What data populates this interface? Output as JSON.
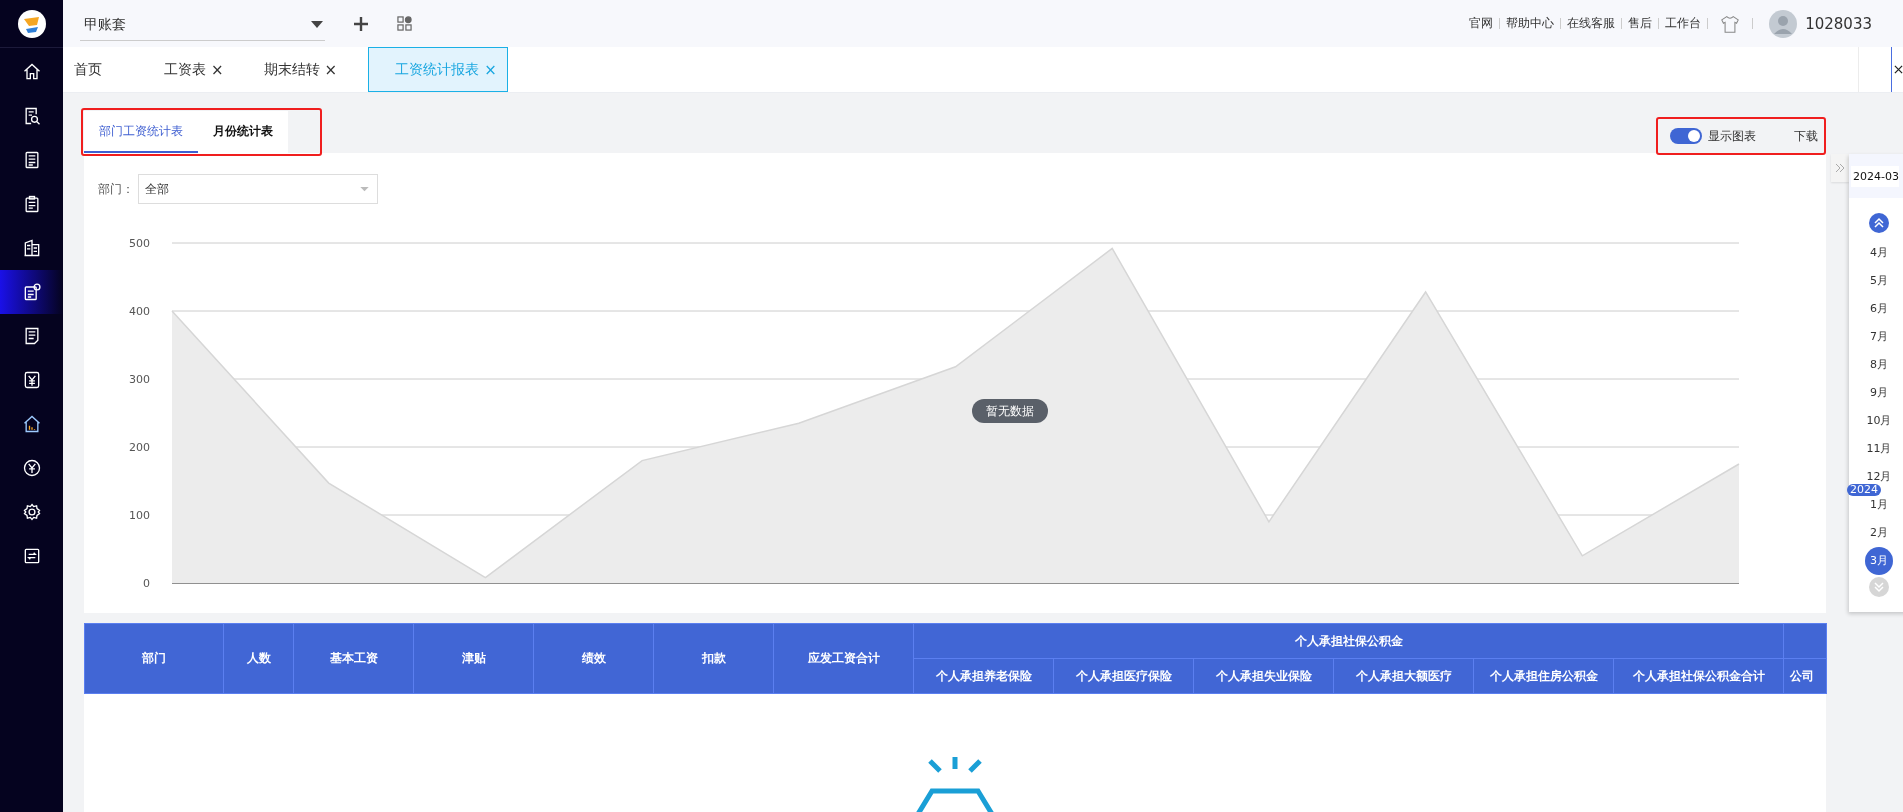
{
  "account": {
    "value": "甲账套"
  },
  "top_links": [
    "官网",
    "帮助中心",
    "在线客服",
    "售后",
    "工作台"
  ],
  "user": {
    "id": "1028033"
  },
  "sidebar": {
    "items": [
      {
        "kind": "home",
        "selected": false
      },
      {
        "kind": "search-doc",
        "selected": false
      },
      {
        "kind": "list",
        "selected": false
      },
      {
        "kind": "clipboard",
        "selected": false
      },
      {
        "kind": "building",
        "selected": false
      },
      {
        "kind": "report",
        "selected": true
      },
      {
        "kind": "document",
        "selected": false
      },
      {
        "kind": "yen-box",
        "selected": false
      },
      {
        "kind": "house",
        "selected": false
      },
      {
        "kind": "yen-circle",
        "selected": false
      },
      {
        "kind": "gear",
        "selected": false
      },
      {
        "kind": "transfer",
        "selected": false
      }
    ]
  },
  "tabs": [
    {
      "label": "首页",
      "selected": false
    },
    {
      "label": "工资表",
      "close": "×",
      "selected": false
    },
    {
      "label": "期末结转",
      "close": "×",
      "selected": false
    },
    {
      "label": "工资统计报表",
      "close": "×",
      "selected": true
    }
  ],
  "sub_tabs": [
    {
      "label": "部门工资统计表",
      "selected": true
    },
    {
      "label": "月份统计表",
      "selected": false
    }
  ],
  "chart_toggle": {
    "label": "显示图表",
    "on": true
  },
  "download": "下载",
  "filter": {
    "label": "部门：",
    "value": "全部"
  },
  "chart": {
    "empty_text": "暂无数据",
    "chart_data": {
      "type": "area",
      "grid": true,
      "ylim": [
        0,
        500
      ],
      "yticks": [
        0,
        100,
        200,
        300,
        400,
        500
      ],
      "values": [
        400,
        147,
        8,
        180,
        235,
        318,
        492,
        90,
        428,
        40,
        175
      ]
    }
  },
  "table": {
    "columns": [
      {
        "label": "部门"
      },
      {
        "label": "人数"
      },
      {
        "label": "基本工资"
      },
      {
        "label": "津贴"
      },
      {
        "label": "绩效"
      },
      {
        "label": "扣款"
      },
      {
        "label": "应发工资合计"
      },
      {
        "label": "个人承担社保公积金",
        "children": [
          {
            "label": "个人承担养老保险"
          },
          {
            "label": "个人承担医疗保险"
          },
          {
            "label": "个人承担失业保险"
          },
          {
            "label": "个人承担大额医疗"
          },
          {
            "label": "个人承担住房公积金"
          },
          {
            "label": "个人承担社保公积金合计"
          }
        ]
      },
      {
        "children": [
          {
            "label": "公司"
          }
        ]
      }
    ]
  },
  "month_picker": {
    "date": "2024-03",
    "months": [
      {
        "label": "4月",
        "selected": false
      },
      {
        "label": "5月",
        "selected": false
      },
      {
        "label": "6月",
        "selected": false
      },
      {
        "label": "7月",
        "selected": false
      },
      {
        "label": "8月",
        "selected": false
      },
      {
        "label": "9月",
        "selected": false
      },
      {
        "label": "10月",
        "selected": false
      },
      {
        "label": "11月",
        "selected": false
      },
      {
        "label": "12月",
        "selected": false
      },
      {
        "label": "1月",
        "year": "2024",
        "selected": false
      },
      {
        "label": "2月",
        "selected": false
      },
      {
        "label": "3月",
        "selected": true
      }
    ]
  }
}
